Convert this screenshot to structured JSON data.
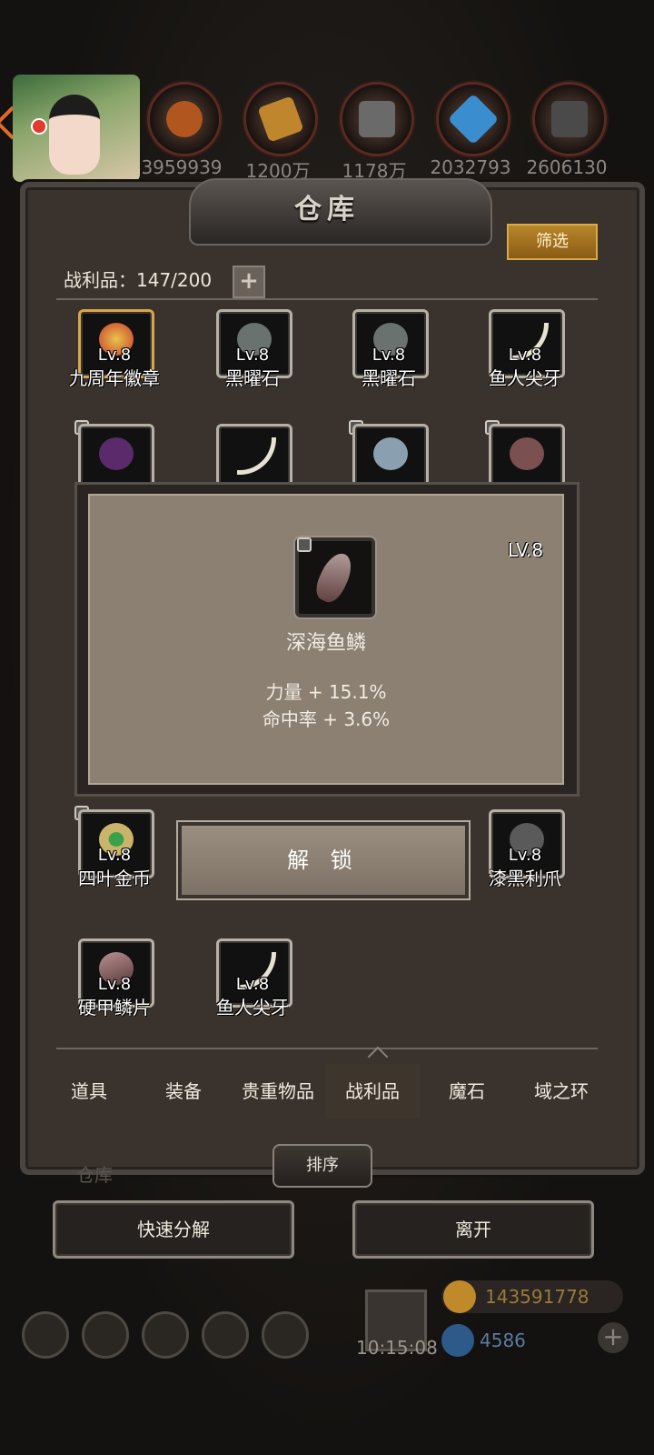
{
  "header": {
    "title": "仓库",
    "filter_label": "筛选",
    "count_label": "战利品：147/200"
  },
  "resources": [
    {
      "value": "3959939",
      "icon": "meat-icon",
      "color": "#b0561e"
    },
    {
      "value": "1200万",
      "icon": "wood-icon",
      "color": "#c0862e"
    },
    {
      "value": "1178万",
      "icon": "iron-icon",
      "color": "#6a6a6a"
    },
    {
      "value": "2032793",
      "icon": "crystal-icon",
      "color": "#3a8ed0"
    },
    {
      "value": "2606130",
      "icon": "ore-icon",
      "color": "#4a4a4a"
    }
  ],
  "items_row1": [
    {
      "name": "九周年徽章",
      "level": "Lv.8",
      "icon": "badge-icon",
      "color": "#c8392e"
    },
    {
      "name": "黑曜石",
      "level": "Lv.8",
      "icon": "obsidian-icon",
      "color": "#6a7270"
    },
    {
      "name": "黑曜石",
      "level": "Lv.8",
      "icon": "obsidian-icon",
      "color": "#6a7270"
    },
    {
      "name": "鱼人尖牙",
      "level": "Lv.8",
      "icon": "fang-icon",
      "color": "#e8e2d2"
    }
  ],
  "items_row4": [
    {
      "name": "四叶金币",
      "level": "Lv.8",
      "icon": "coin-icon",
      "color": "#c9b46a"
    },
    {
      "name": "漆黑利爪",
      "level": "Lv.8",
      "icon": "claw-icon",
      "color": "#5a5a5a"
    }
  ],
  "items_row5": [
    {
      "name": "硬甲鳞片",
      "level": "Lv.8",
      "icon": "scale-icon",
      "color": "#8a5a5a"
    },
    {
      "name": "鱼人尖牙",
      "level": "Lv.8",
      "icon": "fang-icon",
      "color": "#e8e2d2"
    }
  ],
  "popup": {
    "level": "LV.8",
    "name": "深海鱼鳞",
    "stats": [
      "力量 + 15.1%",
      "命中率 + 3.6%"
    ],
    "unlock_label": "解 锁"
  },
  "tabs": [
    {
      "label": "道具"
    },
    {
      "label": "装备"
    },
    {
      "label": "贵重物品"
    },
    {
      "label": "战利品",
      "active": true
    },
    {
      "label": "魔石"
    },
    {
      "label": "域之环"
    }
  ],
  "actions": {
    "sort_label": "排序",
    "quick_decompose_label": "快速分解",
    "leave_label": "离开"
  },
  "hud": {
    "time": "10:15:08",
    "gold": "143591778",
    "gems": "4586",
    "faded_label": "仓库"
  }
}
